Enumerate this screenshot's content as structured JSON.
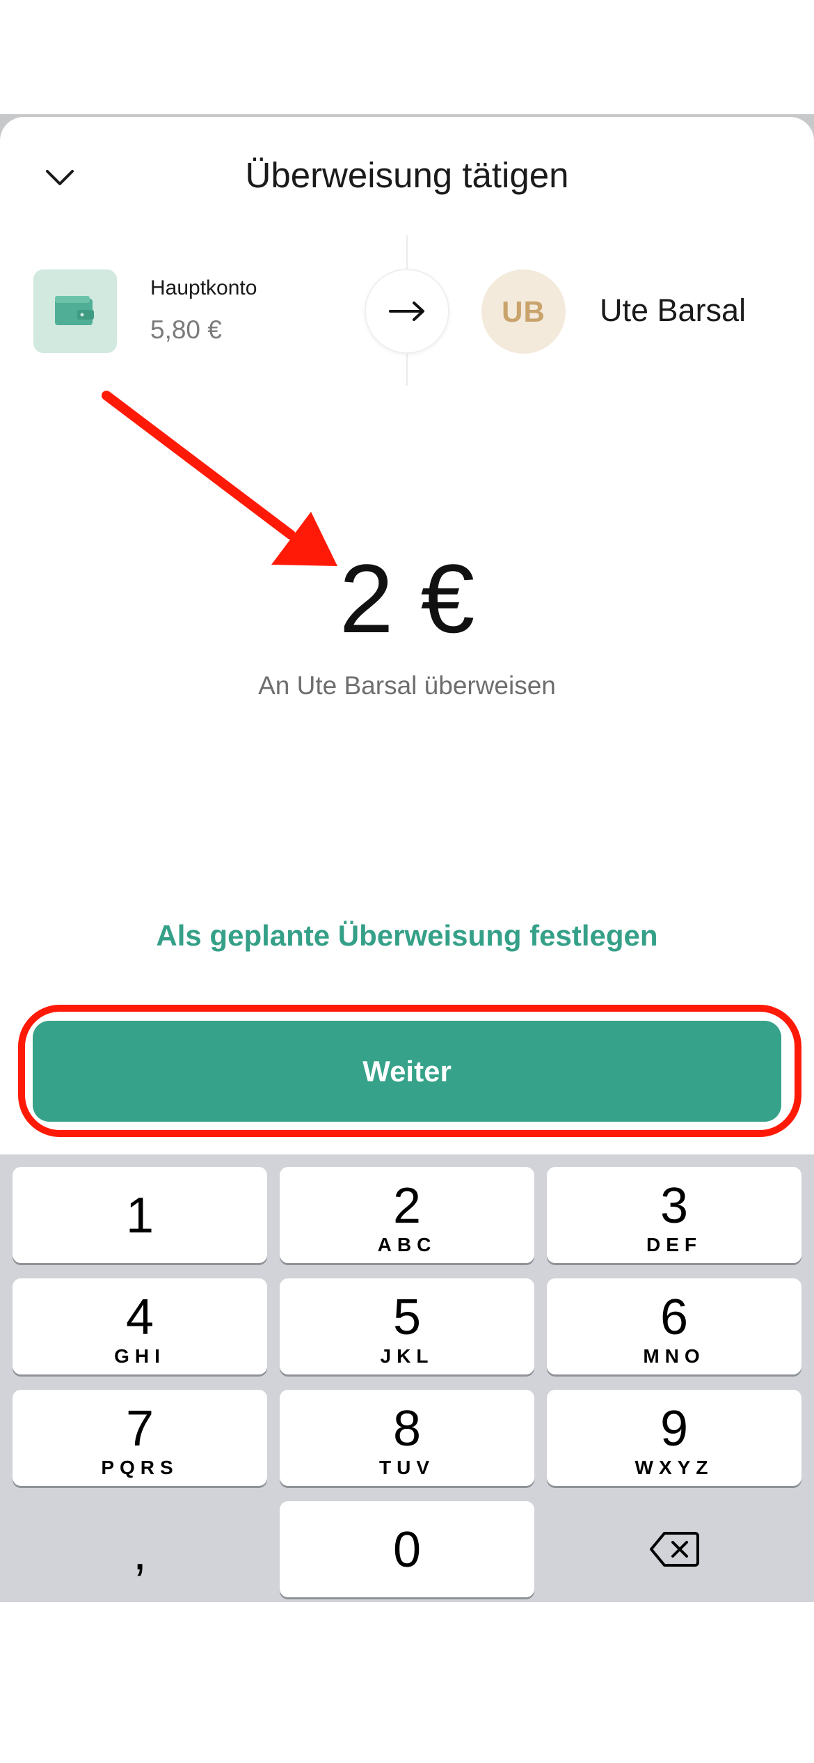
{
  "header": {
    "title": "Überweisung tätigen",
    "close_icon": "chevron-down-icon"
  },
  "source": {
    "name": "Hauptkonto",
    "balance": "5,80 €",
    "icon": "wallet-icon",
    "icon_color": "#d2e9df"
  },
  "transfer_icon": "arrow-right-icon",
  "recipient": {
    "initials": "UB",
    "name": "Ute Barsal",
    "avatar_color": "#f3eadb"
  },
  "amount": {
    "value": "2 €",
    "subtitle": "An Ute Barsal überweisen"
  },
  "actions": {
    "schedule_label": "Als geplante Überweisung festlegen",
    "continue_label": "Weiter"
  },
  "colors": {
    "accent": "#35a289",
    "annotation": "#ff1a08"
  },
  "keypad": {
    "keys": [
      {
        "digit": "1",
        "letters": ""
      },
      {
        "digit": "2",
        "letters": "ABC"
      },
      {
        "digit": "3",
        "letters": "DEF"
      },
      {
        "digit": "4",
        "letters": "GHI"
      },
      {
        "digit": "5",
        "letters": "JKL"
      },
      {
        "digit": "6",
        "letters": "MNO"
      },
      {
        "digit": "7",
        "letters": "PQRS"
      },
      {
        "digit": "8",
        "letters": "TUV"
      },
      {
        "digit": "9",
        "letters": "WXYZ"
      },
      {
        "digit": "0",
        "letters": ""
      }
    ],
    "comma_label": ",",
    "delete_icon": "backspace-icon"
  }
}
